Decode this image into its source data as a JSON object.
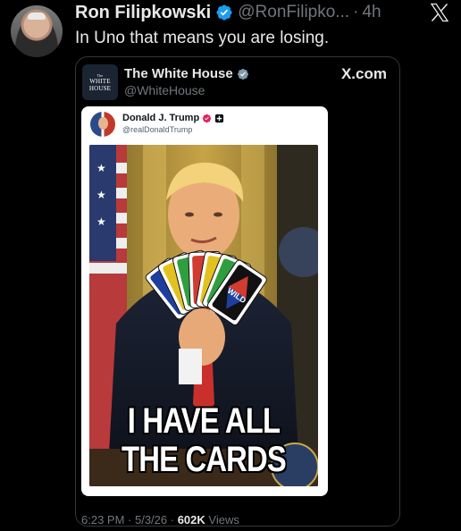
{
  "tweet": {
    "author_name": "Ron Filipkowski",
    "author_handle": "@RonFilipko...",
    "separator": "·",
    "time": "4h",
    "text": "In Uno that means you are losing.",
    "icons": [
      "avatar",
      "verified-badge-icon",
      "x-logo-icon"
    ]
  },
  "quote": {
    "logo_lines": [
      "The",
      "WHITE",
      "HOUSE"
    ],
    "name": "The White House",
    "handle": "@WhiteHouse",
    "source": "X.com",
    "inner_post": {
      "name": "Donald J. Trump",
      "handle": "@realDonaldTrump",
      "image_caption_line1": "I HAVE ALL",
      "image_caption_line2": "THE CARDS",
      "card_text": "WILD"
    },
    "meta": {
      "time": "6:23 PM",
      "sep1": " · ",
      "date": "5/3/26",
      "sep2": " · ",
      "views_count": "602K",
      "views_label": " Views"
    }
  },
  "colors": {
    "background": "#000000",
    "text_primary": "#e7e9ea",
    "text_secondary": "#71767b",
    "verified_blue": "#1d9bf0",
    "verified_gray": "#829aab"
  }
}
